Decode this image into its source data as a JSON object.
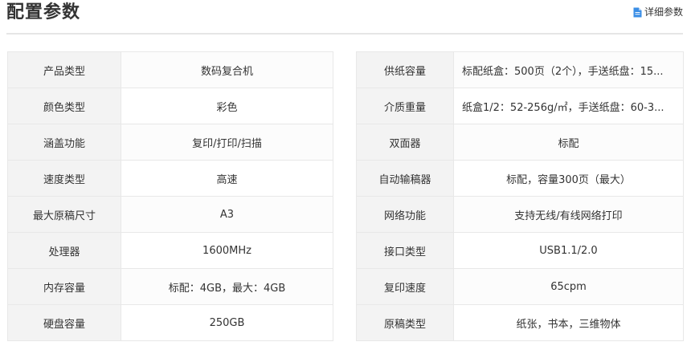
{
  "header": {
    "title": "配置参数",
    "detail_link": "详细参数",
    "detail_icon": "document-icon",
    "icon_color": "#3a8ee6"
  },
  "left_table": [
    {
      "label": "产品类型",
      "value": "数码复合机"
    },
    {
      "label": "颜色类型",
      "value": "彩色"
    },
    {
      "label": "涵盖功能",
      "value": "复印/打印/扫描"
    },
    {
      "label": "速度类型",
      "value": "高速"
    },
    {
      "label": "最大原稿尺寸",
      "value": "A3"
    },
    {
      "label": "处理器",
      "value": "1600MHz"
    },
    {
      "label": "内存容量",
      "value": "标配：4GB，最大：4GB"
    },
    {
      "label": "硬盘容量",
      "value": "250GB"
    }
  ],
  "right_table": [
    {
      "label": "供纸容量",
      "value": "标配纸盒：500页（2个），手送纸盘：15..."
    },
    {
      "label": "介质重量",
      "value": "纸盒1/2：52-256g/㎡，手送纸盘：60-3..."
    },
    {
      "label": "双面器",
      "value": "标配"
    },
    {
      "label": "自动输稿器",
      "value": "标配，容量300页（最大）"
    },
    {
      "label": "网络功能",
      "value": "支持无线/有线网络打印"
    },
    {
      "label": "接口类型",
      "value": "USB1.1/2.0"
    },
    {
      "label": "复印速度",
      "value": "65cpm"
    },
    {
      "label": "原稿类型",
      "value": "纸张，书本，三维物体"
    }
  ]
}
